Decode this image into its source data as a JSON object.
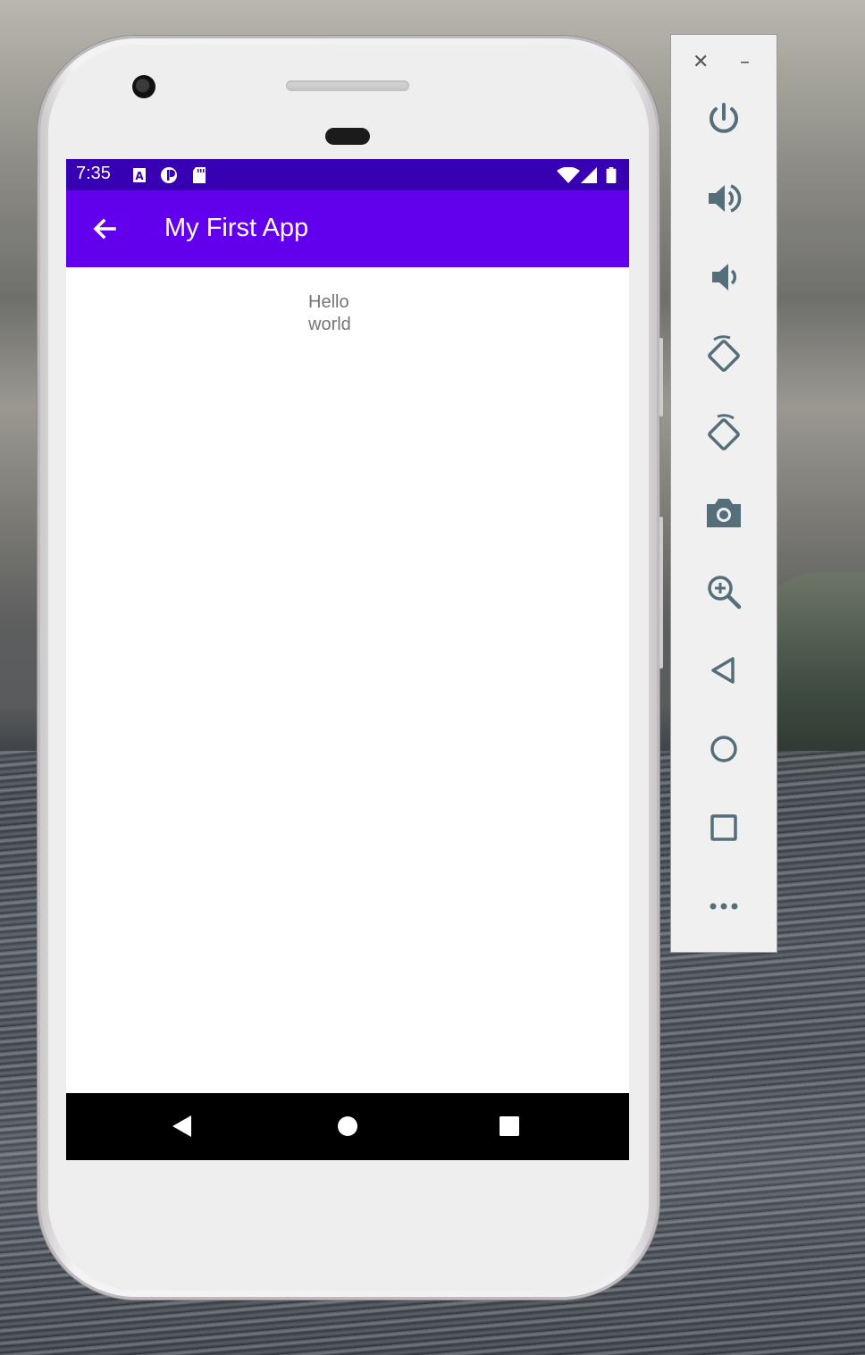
{
  "status_bar": {
    "time": "7:35",
    "left_icons": [
      "autofill-a-icon",
      "play-protect-icon",
      "sd-card-icon"
    ],
    "right_icons": [
      "wifi-icon",
      "cell-signal-icon",
      "battery-icon"
    ]
  },
  "app_bar": {
    "title": "My First App",
    "back_icon": "arrow-back-icon"
  },
  "content": {
    "text_line1": "Hello",
    "text_line2": "world"
  },
  "nav_bar": {
    "buttons": [
      "back-triangle-icon",
      "home-circle-icon",
      "overview-square-icon"
    ]
  },
  "emulator_toolbar": {
    "close": "✕",
    "minimize": "–",
    "buttons": [
      "power-icon",
      "volume-up-icon",
      "volume-down-icon",
      "rotate-left-icon",
      "rotate-right-icon",
      "camera-icon",
      "zoom-icon",
      "back-icon",
      "home-icon",
      "overview-icon",
      "more-icon"
    ]
  },
  "colors": {
    "status_bar": "#3700b3",
    "app_bar": "#6200ee",
    "toolbar_icon": "#546e7a",
    "text_gray": "#757575"
  }
}
